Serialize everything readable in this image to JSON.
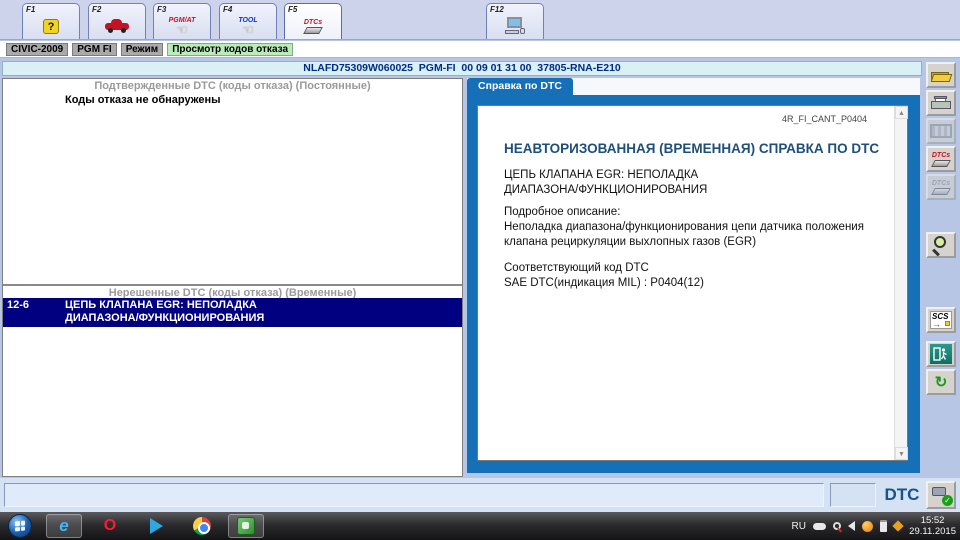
{
  "toolbar": {
    "buttons": [
      {
        "fkey": "F1",
        "icon": "help-icon"
      },
      {
        "fkey": "F2",
        "icon": "vehicle-icon"
      },
      {
        "fkey": "F3",
        "icon": "pgm-at-icon",
        "label": "PGM/AT"
      },
      {
        "fkey": "F4",
        "icon": "tool-icon",
        "label": "TOOL"
      },
      {
        "fkey": "F5",
        "icon": "dtcs-icon",
        "label": "DTCs"
      },
      {
        "fkey": "F12",
        "icon": "computer-icon"
      }
    ],
    "help_glyph": "?"
  },
  "breadcrumb": {
    "items": [
      {
        "label": "CIVIC-2009",
        "highlight": false
      },
      {
        "label": "PGM FI",
        "highlight": false
      },
      {
        "label": "Режим",
        "highlight": false
      },
      {
        "label": "Просмотр кодов отказа",
        "highlight": true
      }
    ]
  },
  "vehicle_header": {
    "text": "NLAFD75309W060025  PGM-FI  00 09 01 31 00  37805-RNA-E210"
  },
  "confirmed_dtc": {
    "title": "Подтвержденные DTC (коды отказа) (Постоянные)",
    "empty_message": "Коды отказа не обнаружены"
  },
  "pending_dtc": {
    "title": "Нерешенные DTC (коды отказа) (Временные)",
    "selected_row": {
      "code": "12-6",
      "text_line1": "ЦЕПЬ КЛАПАНА EGR: НЕПОЛАДКА",
      "text_line2": "ДИАПАЗОНА/ФУНКЦИОНИРОВАНИЯ"
    }
  },
  "help_panel": {
    "tab_label": "Справка по DTC",
    "doc_ref": "4R_FI_CANT_P0404",
    "title": "НЕАВТОРИЗОВАННАЯ (ВРЕМЕННАЯ) СПРАВКА ПО DTC",
    "subject_line1": "ЦЕПЬ КЛАПАНА EGR: НЕПОЛАДКА",
    "subject_line2": "ДИАПАЗОНА/ФУНКЦИОНИРОВАНИЯ",
    "detail_heading": "Подробное описание:",
    "detail_line1": "Неполадка диапазона/функционирования цепи датчика положения",
    "detail_line2": "клапана рециркуляции выхлопных газов (EGR)",
    "code_heading": "Соответствующий код DTC",
    "code_line": "SAE DTC(индикация MIL) : P0404(12)",
    "scroll_up_glyph": "▲",
    "scroll_down_glyph": "▼"
  },
  "side_toolbar": {
    "icons": [
      "open-file",
      "print",
      "film-strip",
      "dtcs-erase",
      "dtc-erase-disabled",
      "zoom",
      "scs",
      "exit",
      "refresh"
    ],
    "dtcs_label": "DTCs",
    "dtc_disabled_label": "DTCs",
    "scs_label": "SCS",
    "scs_arrow": "→",
    "refresh_glyph": "↻"
  },
  "status_bar": {
    "dtc_label": "DTC",
    "check_glyph": "✓"
  },
  "taskbar": {
    "language": "RU",
    "time": "15:52",
    "date": "29.11.2015"
  },
  "colors": {
    "accent_blue": "#1570b8",
    "selection_navy": "#000080",
    "highlight_green": "#b9ecb9",
    "header_cyan": "#d9f0f4",
    "dtc_red": "#c41222"
  }
}
